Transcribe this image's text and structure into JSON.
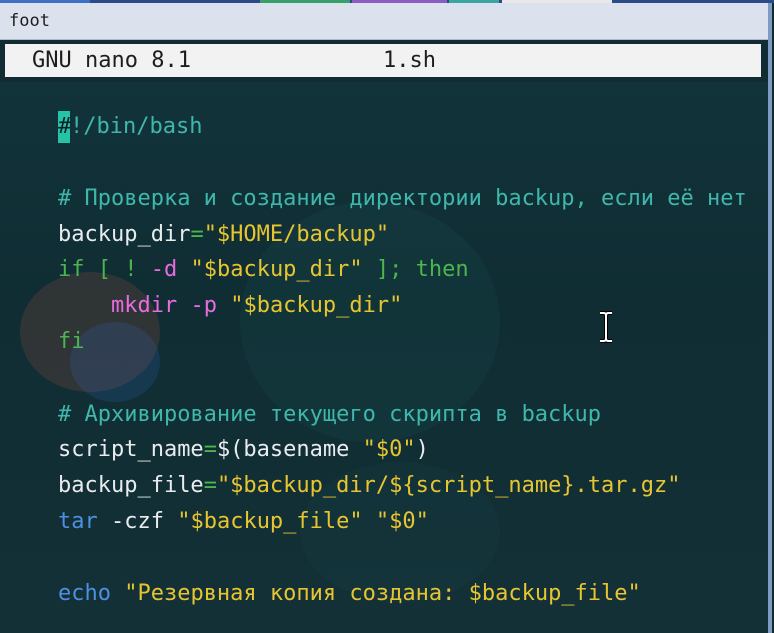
{
  "window": {
    "title": "foot"
  },
  "nano": {
    "version_label": "GNU nano 8.1",
    "filename": "1.sh"
  },
  "code": {
    "shebang_cursor_char": "#",
    "shebang_rest": "!/bin/bash",
    "comment1": "# Проверка и создание директории backup, если её нет",
    "l3_var": "backup_dir",
    "l3_eq": "=",
    "l3_val": "\"$HOME/backup\"",
    "l4_if": "if",
    "l4_cond1": " [ ! ",
    "l4_flag": "-d",
    "l4_space": " ",
    "l4_str": "\"$backup_dir\"",
    "l4_close": " ]; ",
    "l4_then": "then",
    "l5_indent": "    ",
    "l5_cmd": "mkdir",
    "l5_space": " ",
    "l5_flag": "-p",
    "l5_space2": " ",
    "l5_str": "\"$backup_dir\"",
    "l6_fi": "fi",
    "comment2": "# Архивирование текущего скрипта в backup",
    "l8_var": "script_name",
    "l8_eq": "=",
    "l8_rest1": "$(basename ",
    "l8_str": "\"$0\"",
    "l8_rest2": ")",
    "l9_var": "backup_file",
    "l9_eq": "=",
    "l9_str": "\"$backup_dir/${script_name}.tar.gz\"",
    "l10_cmd": "tar",
    "l10_flag": " -czf ",
    "l10_str": "\"$backup_file\" \"$0\"",
    "l12_echo": "echo",
    "l12_space": " ",
    "l12_str": "\"Резервная копия создана: $backup_file\""
  },
  "colors": {
    "comment": "#3fb7ad",
    "string": "#e7c531",
    "keyword": "#4db54f",
    "command": "#e86be0",
    "builtin": "#4d8fe0",
    "cursor": "#25c4a7"
  },
  "icons": {
    "mouse_pointer": "ibeam-cursor-icon"
  }
}
